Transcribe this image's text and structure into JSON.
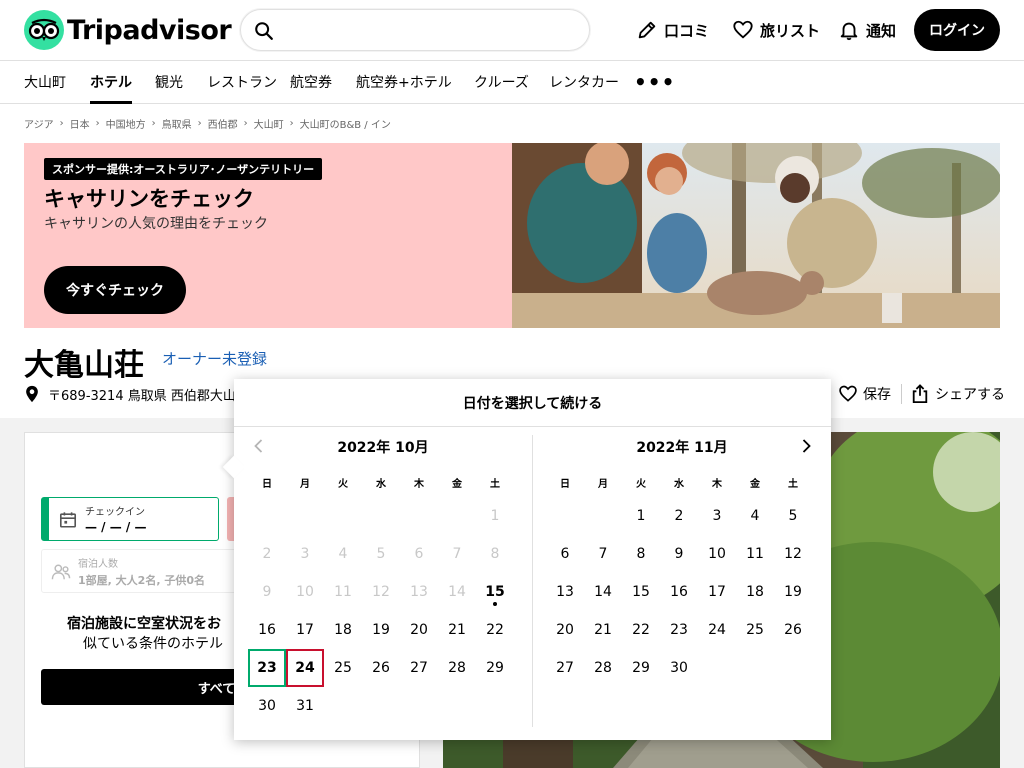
{
  "brand": {
    "name": "Tripadvisor",
    "accent": "#34e0a1"
  },
  "header": {
    "search_placeholder": "",
    "review_label": "口コミ",
    "trips_label": "旅リスト",
    "alerts_label": "通知",
    "login_label": "ログイン"
  },
  "nav": {
    "items": [
      {
        "label": "大山町",
        "active": false
      },
      {
        "label": "ホテル",
        "active": true
      },
      {
        "label": "観光",
        "active": false
      },
      {
        "label": "レストラン",
        "active": false
      },
      {
        "label": "航空券",
        "active": false
      },
      {
        "label": "航空券+ホテル",
        "active": false
      },
      {
        "label": "クルーズ",
        "active": false
      },
      {
        "label": "レンタカー",
        "active": false
      }
    ],
    "more": "•••"
  },
  "breadcrumb": [
    "アジア",
    "日本",
    "中国地方",
    "鳥取県",
    "西伯郡",
    "大山町",
    "大山町のB&B / イン"
  ],
  "ad": {
    "tag": "スポンサー提供:オーストラリア･ノーザンテリトリー",
    "title": "キャサリンをチェック",
    "subtitle": "キャサリンの人気の理由をチェック",
    "button": "今すぐチェック"
  },
  "property": {
    "name": "大亀山荘",
    "owner_link": "オーナー未登録",
    "address": "〒689-3214 鳥取県 西伯郡大山",
    "save_label": "保存",
    "share_label": "シェアする"
  },
  "booking": {
    "checkin_label": "チェックイン",
    "checkin_value": "— / — / —",
    "guests_label": "宿泊人数",
    "guests_value": "1部屋, 大人2名, 子供0名",
    "availability_title": "宿泊施設に空室状況をお",
    "availability_sub": "似ている条件のホテル",
    "see_all_button": "すべて表"
  },
  "datepicker": {
    "heading": "日付を選択して続ける",
    "weekdays": [
      "日",
      "月",
      "火",
      "水",
      "木",
      "金",
      "土"
    ],
    "today": 15,
    "months": [
      {
        "title": "2022年 10月",
        "first_weekday": 6,
        "days": 31,
        "past_until": 14,
        "checkin": 23,
        "checkout": 24
      },
      {
        "title": "2022年 11月",
        "first_weekday": 2,
        "days": 30,
        "past_until": 0,
        "checkin": null,
        "checkout": null
      }
    ]
  }
}
